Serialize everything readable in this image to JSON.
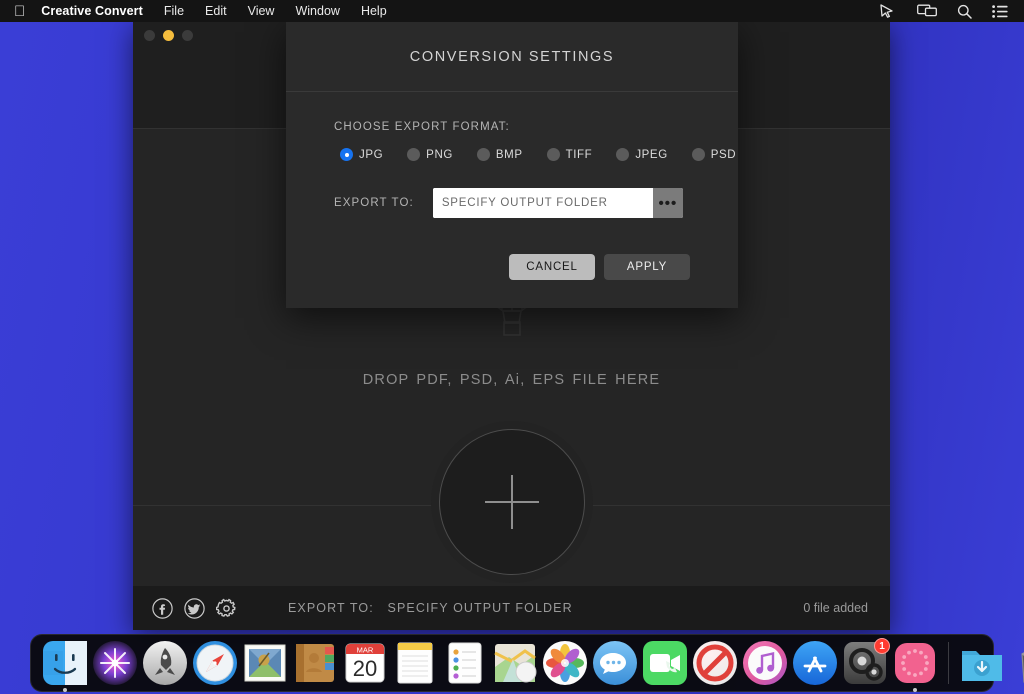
{
  "menubar": {
    "apple_icon": "apple-logo-icon",
    "app_name": "Creative Convert",
    "items": [
      {
        "label": "File"
      },
      {
        "label": "Edit"
      },
      {
        "label": "View"
      },
      {
        "label": "Window"
      },
      {
        "label": "Help"
      }
    ],
    "status_icons": [
      {
        "name": "pointer-cursor-icon"
      },
      {
        "name": "screen-mirroring-icon"
      },
      {
        "name": "search-icon"
      },
      {
        "name": "control-center-icon"
      }
    ]
  },
  "window": {
    "traffic_lights": [
      {
        "name": "close-button",
        "state": "inactive"
      },
      {
        "name": "minimize-button",
        "state": "active"
      },
      {
        "name": "maximize-button",
        "state": "inactive"
      }
    ],
    "dropzone": {
      "graphic": "hot-air-balloon-icon",
      "text": "DROP  PDF,  PSD,  Ai,  EPS  FILE  HERE",
      "add_button_icon": "plus-icon"
    },
    "statusbar": {
      "social": [
        {
          "name": "facebook-icon"
        },
        {
          "name": "twitter-icon"
        },
        {
          "name": "gear-icon"
        }
      ],
      "export_label": "EXPORT TO:",
      "export_value": "SPECIFY OUTPUT FOLDER",
      "file_count": "0 file added"
    }
  },
  "modal": {
    "title": "CONVERSION SETTINGS",
    "format_label": "CHOOSE EXPORT FORMAT:",
    "formats": [
      {
        "label": "JPG",
        "selected": true
      },
      {
        "label": "PNG",
        "selected": false
      },
      {
        "label": "BMP",
        "selected": false
      },
      {
        "label": "TIFF",
        "selected": false
      },
      {
        "label": "JPEG",
        "selected": false
      },
      {
        "label": "PSD",
        "selected": false
      }
    ],
    "export_label": "EXPORT TO:",
    "export_placeholder": "SPECIFY OUTPUT FOLDER",
    "export_value": "",
    "browse_label": "•••",
    "cancel_label": "CANCEL",
    "apply_label": "APPLY",
    "accent_color": "#1673f0"
  },
  "dock": {
    "items": [
      {
        "name": "finder-icon",
        "running": true,
        "badge": ""
      },
      {
        "name": "siri-icon",
        "running": false,
        "badge": ""
      },
      {
        "name": "launchpad-icon",
        "running": false,
        "badge": ""
      },
      {
        "name": "safari-icon",
        "running": false,
        "badge": ""
      },
      {
        "name": "mail-icon",
        "running": false,
        "badge": ""
      },
      {
        "name": "contacts-icon",
        "running": false,
        "badge": ""
      },
      {
        "name": "calendar-icon",
        "running": false,
        "badge": "",
        "month": "MAR",
        "day": "20"
      },
      {
        "name": "notes-icon",
        "running": false,
        "badge": ""
      },
      {
        "name": "reminders-icon",
        "running": false,
        "badge": ""
      },
      {
        "name": "maps-icon",
        "running": false,
        "badge": ""
      },
      {
        "name": "photos-icon",
        "running": false,
        "badge": ""
      },
      {
        "name": "messages-icon",
        "running": false,
        "badge": ""
      },
      {
        "name": "facetime-icon",
        "running": false,
        "badge": ""
      },
      {
        "name": "do-not-disturb-icon",
        "running": false,
        "badge": ""
      },
      {
        "name": "itunes-icon",
        "running": false,
        "badge": ""
      },
      {
        "name": "app-store-icon",
        "running": false,
        "badge": ""
      },
      {
        "name": "system-preferences-icon",
        "running": false,
        "badge": "1"
      },
      {
        "name": "creative-convert-icon",
        "running": true,
        "badge": ""
      }
    ],
    "right_items": [
      {
        "name": "downloads-folder-icon"
      },
      {
        "name": "trash-icon"
      }
    ]
  }
}
